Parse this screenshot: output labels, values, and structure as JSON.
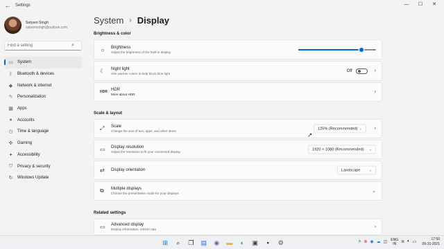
{
  "window": {
    "title": "Settings",
    "controls": [
      "—",
      "☐",
      "✕"
    ]
  },
  "profile": {
    "name": "Satyam Singh",
    "email": "satyamsingh@outlook.com"
  },
  "search": {
    "placeholder": "Find a setting"
  },
  "nav": [
    {
      "label": "System",
      "icon": "monitor-icon",
      "active": true
    },
    {
      "label": "Bluetooth & devices",
      "icon": "bluetooth-icon"
    },
    {
      "label": "Network & internet",
      "icon": "wifi-icon"
    },
    {
      "label": "Personalization",
      "icon": "brush-icon"
    },
    {
      "label": "Apps",
      "icon": "apps-icon"
    },
    {
      "label": "Accounts",
      "icon": "person-icon"
    },
    {
      "label": "Time & language",
      "icon": "globe-clock-icon"
    },
    {
      "label": "Gaming",
      "icon": "controller-icon"
    },
    {
      "label": "Accessibility",
      "icon": "accessibility-icon"
    },
    {
      "label": "Privacy & security",
      "icon": "shield-icon"
    },
    {
      "label": "Windows Update",
      "icon": "refresh-icon"
    }
  ],
  "breadcrumb": {
    "parent": "System",
    "separator": "›",
    "current": "Display"
  },
  "sections": {
    "brightness_color": "Brightness & color",
    "scale_layout": "Scale & layout",
    "related": "Related settings"
  },
  "brightness": {
    "label": "Brightness",
    "desc": "Adjust the brightness of the built-in display",
    "value": 0.81
  },
  "night_light": {
    "label": "Night light",
    "desc": "Use warmer colors to help block blue light",
    "state": "Off"
  },
  "hdr": {
    "label": "HDR",
    "link": "More about HDR"
  },
  "scale": {
    "label": "Scale",
    "desc": "Change the size of text, apps, and other items",
    "value": "125% (Recommended)"
  },
  "resolution": {
    "label": "Display resolution",
    "desc": "Adjust the resolution to fit your connected display",
    "value": "1920 × 1080 (Recommended)"
  },
  "orientation": {
    "label": "Display orientation",
    "value": "Landscape"
  },
  "multiple_displays": {
    "label": "Multiple displays",
    "desc": "Choose the presentation mode for your displays"
  },
  "advanced_display": {
    "label": "Advanced display",
    "desc": "Display information, refresh rate"
  },
  "taskbar": {
    "lang_line1": "ENG",
    "lang_line2": "IN",
    "time": "17:50",
    "date": "09-10-2021"
  },
  "colors": {
    "accent": "#0067c0",
    "background": "#f3f3f3",
    "card": "#fbfbfb"
  }
}
